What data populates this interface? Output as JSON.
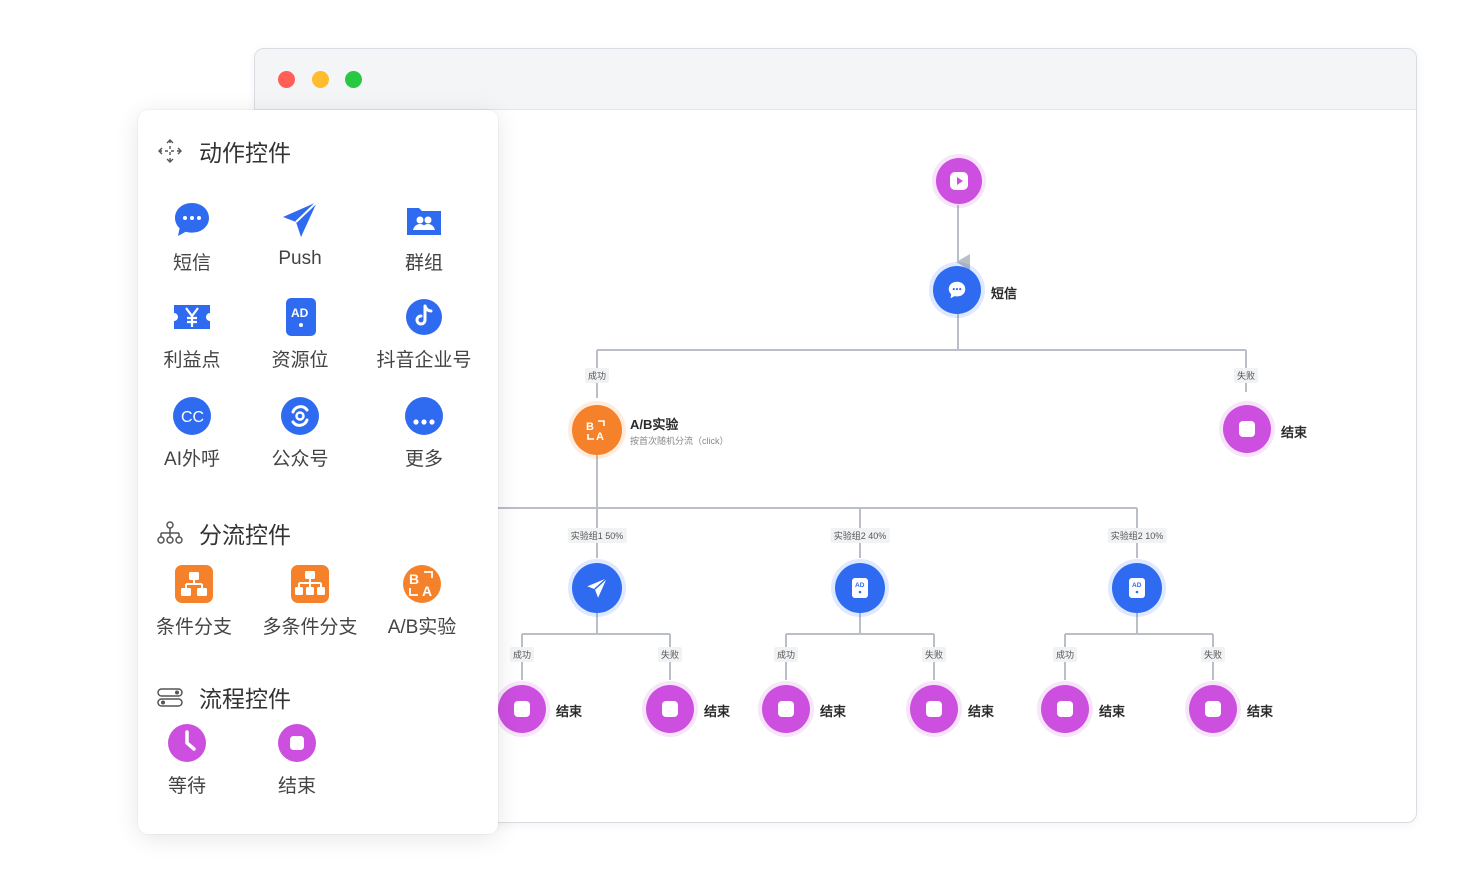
{
  "panel": {
    "sections": {
      "action": {
        "title": "动作控件",
        "icon": "move-arrows-icon"
      },
      "branch": {
        "title": "分流控件",
        "icon": "hierarchy-icon"
      },
      "process": {
        "title": "流程控件",
        "icon": "process-toggle-icon"
      }
    },
    "action_tools": [
      {
        "label": "短信",
        "icon": "chat-bubble-icon"
      },
      {
        "label": "Push",
        "icon": "paper-plane-icon"
      },
      {
        "label": "群组",
        "icon": "group-folder-icon"
      },
      {
        "label": "利益点",
        "icon": "yen-ticket-icon"
      },
      {
        "label": "资源位",
        "icon": "ad-slot-icon"
      },
      {
        "label": "抖音企业号",
        "icon": "douyin-icon"
      },
      {
        "label": "AI外呼",
        "icon": "cc-call-icon"
      },
      {
        "label": "公众号",
        "icon": "official-account-icon"
      },
      {
        "label": "更多",
        "icon": "more-icon"
      }
    ],
    "branch_tools": [
      {
        "label": "条件分支",
        "icon": "condition-branch-icon"
      },
      {
        "label": "多条件分支",
        "icon": "multi-condition-branch-icon"
      },
      {
        "label": "A/B实验",
        "icon": "ab-test-icon"
      }
    ],
    "process_tools": [
      {
        "label": "等待",
        "icon": "clock-icon"
      },
      {
        "label": "结束",
        "icon": "stop-icon"
      }
    ]
  },
  "flow": {
    "sms_label": "短信",
    "ab_label": "A/B实验",
    "ab_sub": "按首次随机分流（click）",
    "end_label": "结束",
    "success_tag": "成功",
    "fail_tag": "失败",
    "group_tags": [
      "实验组1 50%",
      "实验组2 40%",
      "实验组2 10%"
    ]
  },
  "colors": {
    "blue": "#2f6bf0",
    "orange": "#f5822a",
    "purple": "#cc4fe0",
    "edge": "#b9bec7"
  }
}
